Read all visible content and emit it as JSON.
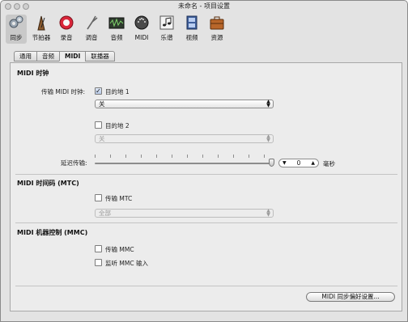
{
  "window": {
    "title": "未命名 - 项目设置"
  },
  "toolbar": {
    "items": [
      {
        "label": "同步",
        "icon": "sync-gears-icon"
      },
      {
        "label": "节拍器",
        "icon": "metronome-icon"
      },
      {
        "label": "录音",
        "icon": "record-icon"
      },
      {
        "label": "调音",
        "icon": "tuning-fork-icon"
      },
      {
        "label": "音频",
        "icon": "audio-waveform-icon"
      },
      {
        "label": "MIDI",
        "icon": "midi-connector-icon"
      },
      {
        "label": "乐谱",
        "icon": "score-notes-icon"
      },
      {
        "label": "视频",
        "icon": "video-film-icon"
      },
      {
        "label": "资源",
        "icon": "briefcase-icon"
      }
    ]
  },
  "tabs": [
    {
      "label": "通用"
    },
    {
      "label": "音频"
    },
    {
      "label": "MIDI"
    },
    {
      "label": "联播器"
    }
  ],
  "midi_clock": {
    "title": "MIDI 时钟",
    "transmit_label": "传输 MIDI 时钟:",
    "dest1_label": "目的地 1",
    "dest1_checked": true,
    "dest1_value": "关",
    "dest2_label": "目的地 2",
    "dest2_checked": false,
    "dest2_value": "关",
    "delay_label": "延迟传输:",
    "delay_value": "0",
    "delay_unit": "毫秒"
  },
  "mtc": {
    "title": "MIDI 时间码 (MTC)",
    "transmit_label": "传输 MTC",
    "transmit_checked": false,
    "select_value": "全部"
  },
  "mmc": {
    "title": "MIDI 机器控制 (MMC)",
    "transmit_label": "传输 MMC",
    "listen_label": "监听 MMC 输入"
  },
  "footer": {
    "sync_prefs_button": "MIDI 同步偏好设置..."
  },
  "colors": {
    "record": "#d9263a",
    "panel": "#ececec"
  }
}
